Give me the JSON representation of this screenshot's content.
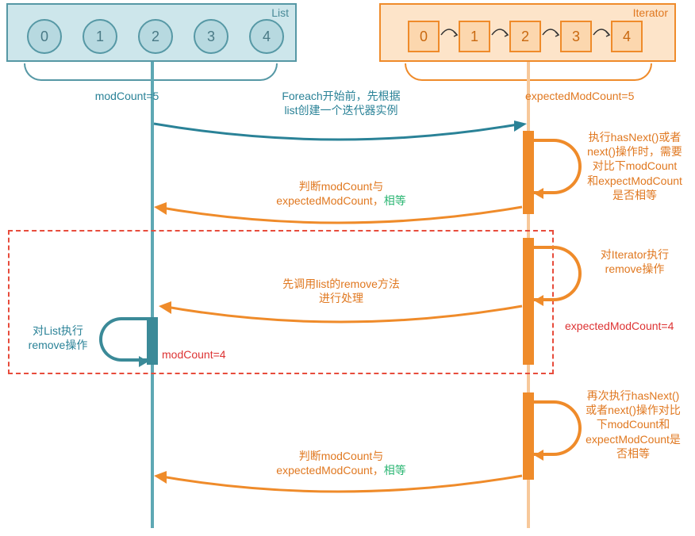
{
  "participants": {
    "list": {
      "label": "List",
      "nodes": [
        "0",
        "1",
        "2",
        "3",
        "4"
      ]
    },
    "iterator": {
      "label": "Iterator",
      "nodes": [
        "0",
        "1",
        "2",
        "3",
        "4"
      ]
    }
  },
  "labels": {
    "modCount5": "modCount=5",
    "expectedModCount5": "expectedModCount=5",
    "createIterator_l1": "Foreach开始前，先根据",
    "createIterator_l2": "list创建一个迭代器实例",
    "hasNextNote_l1": "执行hasNext()或者",
    "hasNextNote_l2": "next()操作时，需要",
    "hasNextNote_l3": "对比下modCount",
    "hasNextNote_l4": "和expectModCount",
    "hasNextNote_l5": "是否相等",
    "compare_prefix_l1": "判断modCount与",
    "compare_prefix_l2": "expectedModCount，",
    "compare_equal": "相等",
    "iterRemove_l1": "对Iterator执行",
    "iterRemove_l2": "remove操作",
    "listRemoveCall_l1": "先调用list的remove方法",
    "listRemoveCall_l2": "进行处理",
    "expectedModCount4": "expectedModCount=4",
    "listRemoveNote_l1": "对List执行",
    "listRemoveNote_l2": "remove操作",
    "modCount4": "modCount=4",
    "again_l1": "再次执行hasNext()",
    "again_l2": "或者next()操作对比",
    "again_l3": "下modCount和",
    "again_l4": "expectModCount是",
    "again_l5": "否相等"
  },
  "colors": {
    "teal": "#2a8297",
    "orange": "#e07820",
    "red": "#d33",
    "frame_red": "#e74c3c",
    "green": "#2bb673"
  }
}
